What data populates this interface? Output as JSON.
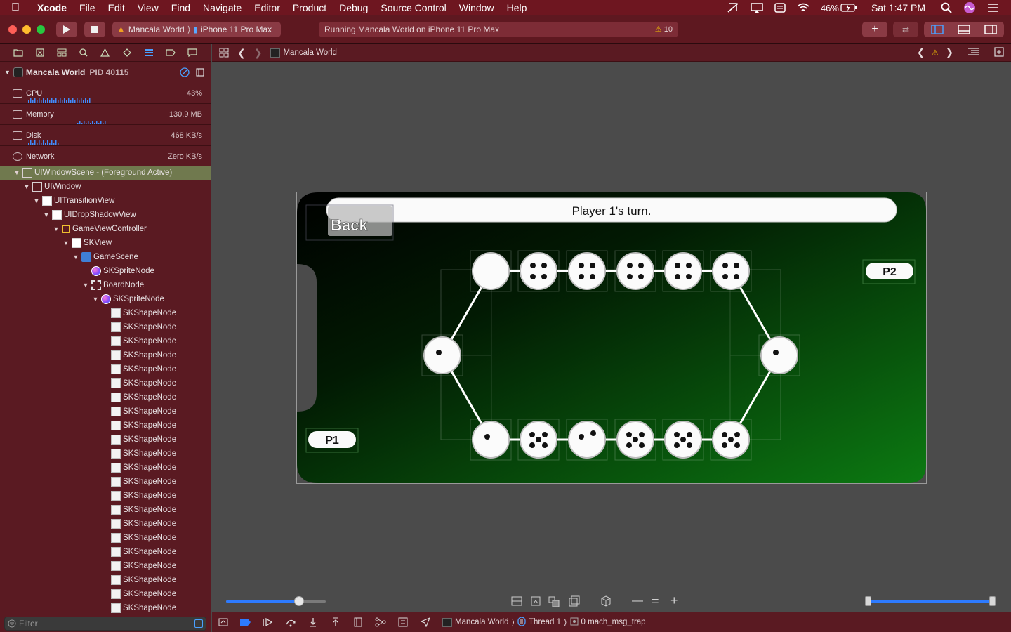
{
  "menubar": {
    "app": "Xcode",
    "items": [
      "File",
      "Edit",
      "View",
      "Find",
      "Navigate",
      "Editor",
      "Product",
      "Debug",
      "Source Control",
      "Window",
      "Help"
    ],
    "battery": "46%",
    "clock": "Sat 1:47 PM"
  },
  "toolbar": {
    "scheme_name": "Mancala World",
    "destination": "iPhone 11 Pro Max",
    "activity_text": "Running Mancala World on iPhone 11 Pro Max",
    "warning_count": "10"
  },
  "navigator": {
    "process_name": "Mancala World",
    "process_pid": "PID 40115",
    "gauges": [
      {
        "label": "CPU",
        "value": "43%"
      },
      {
        "label": "Memory",
        "value": "130.9 MB"
      },
      {
        "label": "Disk",
        "value": "468 KB/s"
      },
      {
        "label": "Network",
        "value": "Zero KB/s"
      }
    ],
    "filter_placeholder": "Filter",
    "tree": [
      {
        "label": "UIWindowScene - (Foreground Active)",
        "level": 0,
        "icon": "box",
        "selected": true
      },
      {
        "label": "UIWindow",
        "level": 1,
        "icon": "box"
      },
      {
        "label": "UITransitionView",
        "level": 2,
        "icon": "white"
      },
      {
        "label": "UIDropShadowView",
        "level": 3,
        "icon": "white"
      },
      {
        "label": "GameViewController",
        "level": 4,
        "icon": "yellow"
      },
      {
        "label": "SKView",
        "level": 5,
        "icon": "white"
      },
      {
        "label": "GameScene",
        "level": 6,
        "icon": "scene"
      },
      {
        "label": "SKSpriteNode",
        "level": 7,
        "icon": "sprite",
        "leaf": true
      },
      {
        "label": "BoardNode",
        "level": 7,
        "icon": "bracket"
      },
      {
        "label": "SKSpriteNode",
        "level": 8,
        "icon": "sprite"
      },
      {
        "label": "SKShapeNode",
        "level": 9,
        "icon": "shape",
        "leaf": true
      },
      {
        "label": "SKShapeNode",
        "level": 9,
        "icon": "shape",
        "leaf": true
      },
      {
        "label": "SKShapeNode",
        "level": 9,
        "icon": "shape",
        "leaf": true
      },
      {
        "label": "SKShapeNode",
        "level": 9,
        "icon": "shape",
        "leaf": true
      },
      {
        "label": "SKShapeNode",
        "level": 9,
        "icon": "shape",
        "leaf": true
      },
      {
        "label": "SKShapeNode",
        "level": 9,
        "icon": "shape",
        "leaf": true
      },
      {
        "label": "SKShapeNode",
        "level": 9,
        "icon": "shape",
        "leaf": true
      },
      {
        "label": "SKShapeNode",
        "level": 9,
        "icon": "shape",
        "leaf": true
      },
      {
        "label": "SKShapeNode",
        "level": 9,
        "icon": "shape",
        "leaf": true
      },
      {
        "label": "SKShapeNode",
        "level": 9,
        "icon": "shape",
        "leaf": true
      },
      {
        "label": "SKShapeNode",
        "level": 9,
        "icon": "shape",
        "leaf": true
      },
      {
        "label": "SKShapeNode",
        "level": 9,
        "icon": "shape",
        "leaf": true
      },
      {
        "label": "SKShapeNode",
        "level": 9,
        "icon": "shape",
        "leaf": true
      },
      {
        "label": "SKShapeNode",
        "level": 9,
        "icon": "shape",
        "leaf": true
      },
      {
        "label": "SKShapeNode",
        "level": 9,
        "icon": "shape",
        "leaf": true
      },
      {
        "label": "SKShapeNode",
        "level": 9,
        "icon": "shape",
        "leaf": true
      },
      {
        "label": "SKShapeNode",
        "level": 9,
        "icon": "shape",
        "leaf": true
      },
      {
        "label": "SKShapeNode",
        "level": 9,
        "icon": "shape",
        "leaf": true
      },
      {
        "label": "SKShapeNode",
        "level": 9,
        "icon": "shape",
        "leaf": true
      },
      {
        "label": "SKShapeNode",
        "level": 9,
        "icon": "shape",
        "leaf": true
      },
      {
        "label": "SKShapeNode",
        "level": 9,
        "icon": "shape",
        "leaf": true
      },
      {
        "label": "SKShapeNode",
        "level": 9,
        "icon": "shape",
        "leaf": true
      }
    ]
  },
  "jumpbar": {
    "breadcrumb": "Mancala World"
  },
  "game": {
    "turn_text": "Player 1's turn.",
    "back_label": "Back",
    "p1_label": "P1",
    "p2_label": "P2",
    "top_pits_seeds": [
      0,
      4,
      4,
      4,
      4,
      4
    ],
    "bottom_pits_seeds": [
      1,
      5,
      2,
      5,
      5,
      5
    ],
    "left_store_seeds": 1,
    "right_store_seeds": 1
  },
  "debugbar": {
    "target": "Mancala World",
    "thread": "Thread 1",
    "frame": "0 mach_msg_trap"
  },
  "colors": {
    "accent": "#2d7bff",
    "board_dark": "#000000",
    "board_green": "#0c7a12",
    "titlebar": "#6e1620"
  },
  "sliders": {
    "spacing_fraction": 0.73,
    "range_start_fraction": 0.0,
    "range_end_fraction": 1.0
  }
}
